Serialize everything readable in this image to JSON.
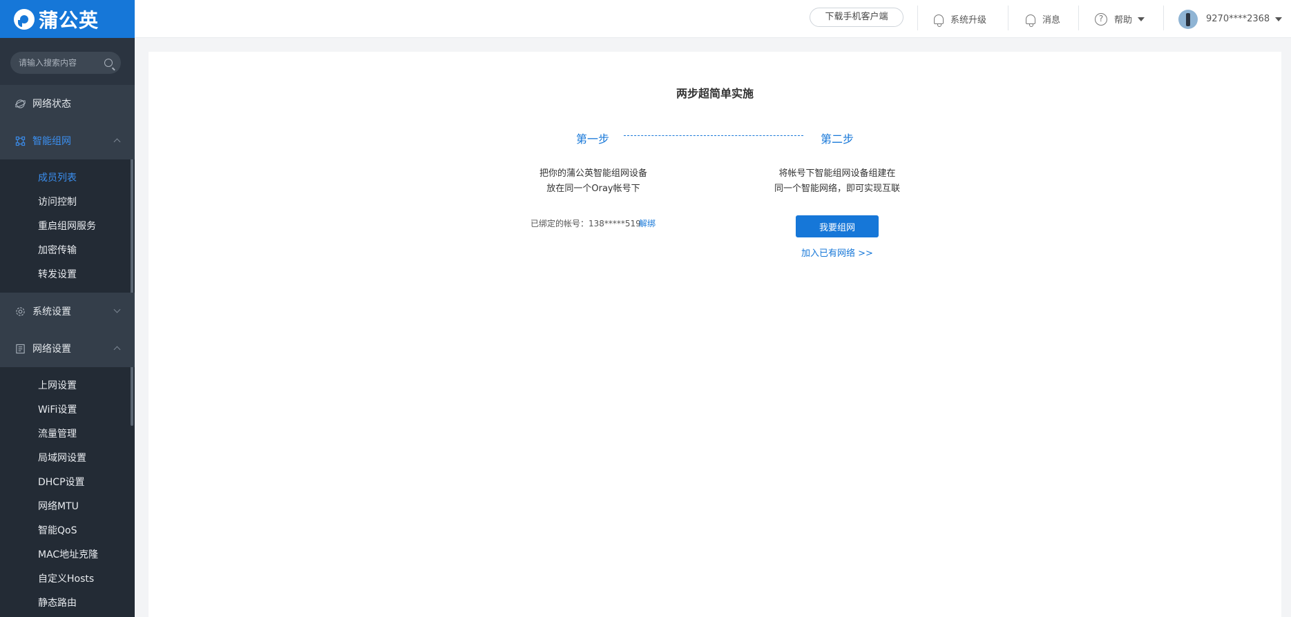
{
  "brand": {
    "name": "蒲公英"
  },
  "search": {
    "placeholder": "请输入搜索内容"
  },
  "sidebar": {
    "groups": [
      {
        "label": "网络状态",
        "icon": "globe-icon",
        "expanded": false
      },
      {
        "label": "智能组网",
        "icon": "network-icon",
        "expanded": true,
        "active": true,
        "items": [
          "成员列表",
          "访问控制",
          "重启组网服务",
          "加密传输",
          "转发设置"
        ],
        "current": "成员列表"
      },
      {
        "label": "系统设置",
        "icon": "gear-icon",
        "expanded": false
      },
      {
        "label": "网络设置",
        "icon": "document-icon",
        "expanded": true,
        "items": [
          "上网设置",
          "WiFi设置",
          "流量管理",
          "局域网设置",
          "DHCP设置",
          "网络MTU",
          "智能QoS",
          "MAC地址克隆",
          "自定义Hosts",
          "静态路由"
        ]
      }
    ]
  },
  "header": {
    "download_label": "下载手机客户端",
    "upgrade_label": "系统升级",
    "message_label": "消息",
    "help_label": "帮助",
    "account": "9270****2368"
  },
  "main": {
    "title": "两步超简单实施",
    "step1": {
      "label": "第一步",
      "desc_line1": "把你的蒲公英智能组网设备",
      "desc_line2": "放在同一个Oray帐号下",
      "bound_account": "已绑定的帐号：138*****519",
      "unbind_label": "解绑"
    },
    "step2": {
      "label": "第二步",
      "desc_line1": "将帐号下智能组网设备组建在",
      "desc_line2": "同一个智能网络，即可实现互联",
      "create_button": "我要组网",
      "join_link": "加入已有网络 >>"
    }
  },
  "colors": {
    "accent": "#1677d8",
    "sidebar_bg": "#2b3440"
  }
}
